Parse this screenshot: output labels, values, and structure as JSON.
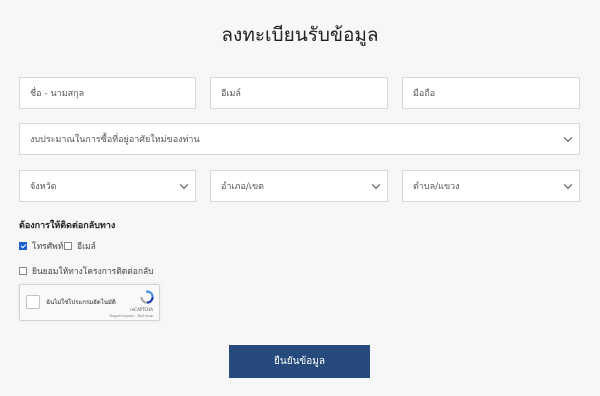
{
  "title": "ลงทะเบียนรับข้อมูล",
  "form": {
    "name_placeholder": "ชื่อ - นามสกุล",
    "email_placeholder": "อีเมล์",
    "mobile_placeholder": "มือถือ",
    "budget_select": "งบประมาณในการซื้อที่อยู่อาศัยใหม่ของท่าน",
    "province_select": "จังหวัด",
    "district_select": "อำเภอ/เขต",
    "subdistrict_select": "ตำบล/แขวง"
  },
  "contact": {
    "label": "ต้องการให้ติดต่อกลับทาง",
    "phone_label": "โทรศัพท์",
    "phone_checked": true,
    "email_label": "อีเมล์",
    "email_checked": false
  },
  "consent": {
    "label": "ยินยอมให้ทางโครงการติดต่อกลับ",
    "checked": false
  },
  "recaptcha": {
    "label": "ฉันไม่ใช่โปรแกรมอัตโนมัติ",
    "brand": "reCAPTCHA",
    "links": "ข้อมูลส่วนบุคคล - ข้อกำหนด"
  },
  "submit_label": "ยืนยันข้อมูล",
  "colors": {
    "background": "#f7f7f7",
    "submit_button": "#254a7b",
    "checkbox_checked": "#1a5fd0"
  }
}
